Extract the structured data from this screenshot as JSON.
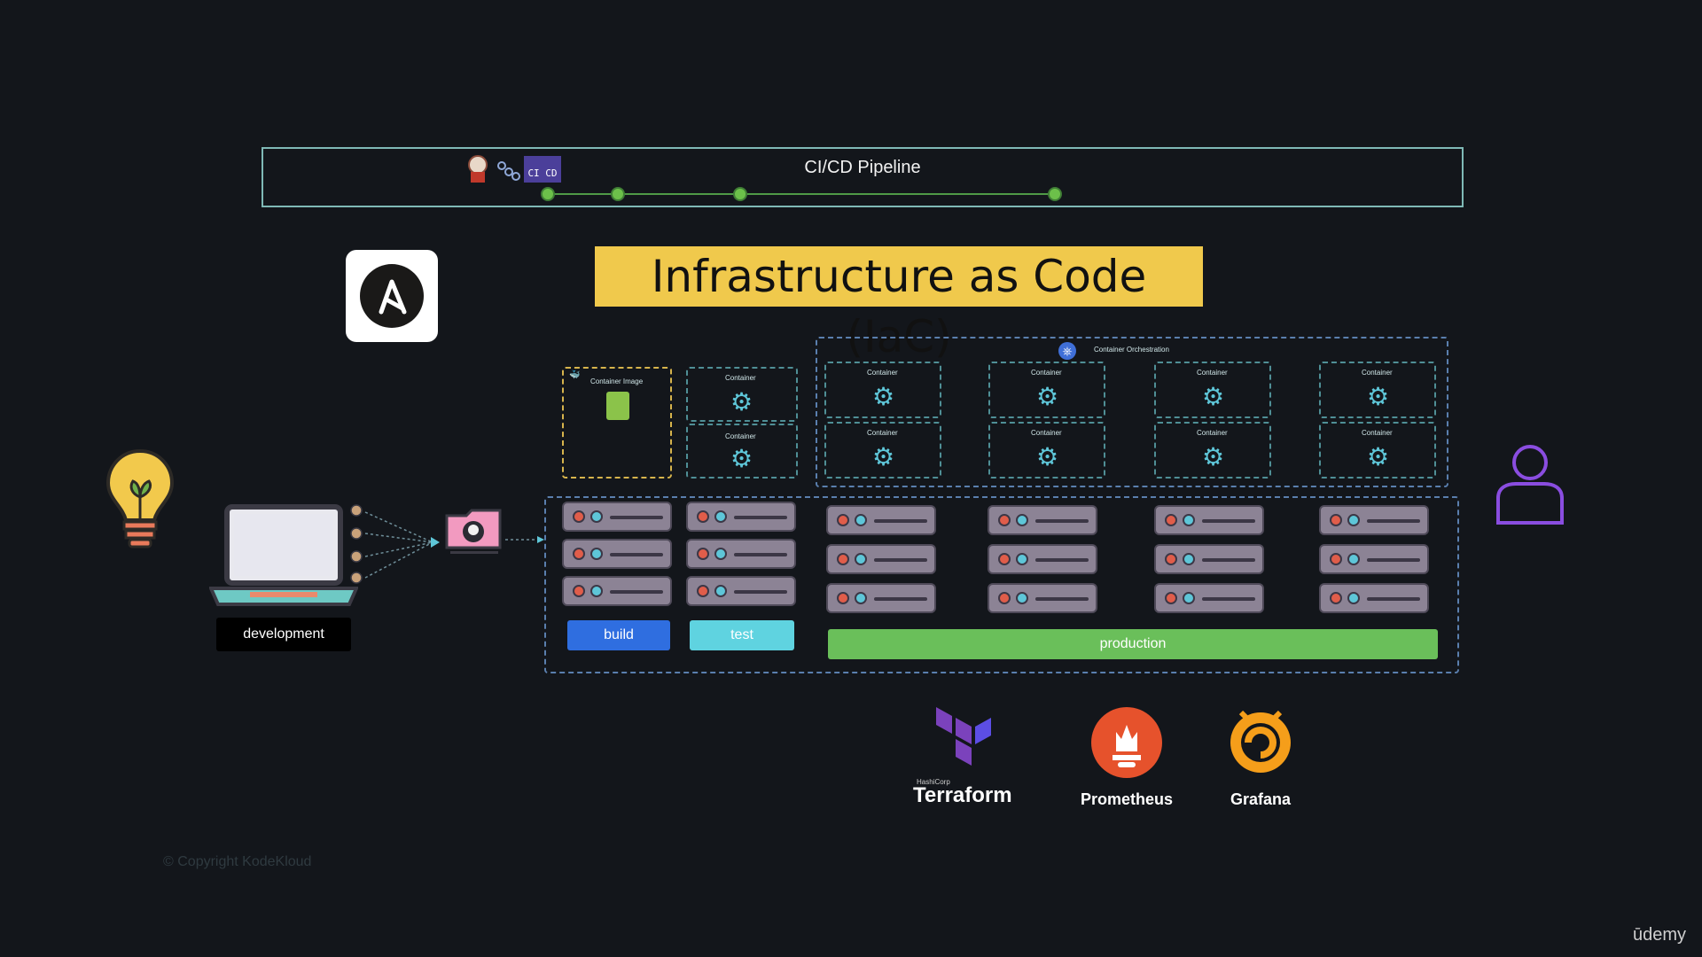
{
  "pipeline": {
    "title": "CI/CD Pipeline",
    "badge": "CI CD"
  },
  "banner": {
    "title": "Infrastructure as Code (IaC)"
  },
  "orchestration": {
    "label": "Container Orchestration"
  },
  "container_image": {
    "label": "Container Image"
  },
  "container": {
    "label": "Container"
  },
  "envs": {
    "build": "build",
    "test": "test",
    "production": "production"
  },
  "dev": {
    "label": "development"
  },
  "tools": {
    "terraform": "Terraform",
    "terraform_vendor": "HashiCorp",
    "prometheus": "Prometheus",
    "grafana": "Grafana"
  },
  "footer": {
    "copyright": "© Copyright KodeKloud",
    "brand": "ūdemy"
  },
  "colors": {
    "background": "#13161b",
    "banner": "#f0c94c",
    "build": "#2f6ee0",
    "test": "#5fd3e0",
    "production": "#6abf5a",
    "pipeline_border": "#7fb9b6",
    "dashed": "#4f8f96"
  }
}
